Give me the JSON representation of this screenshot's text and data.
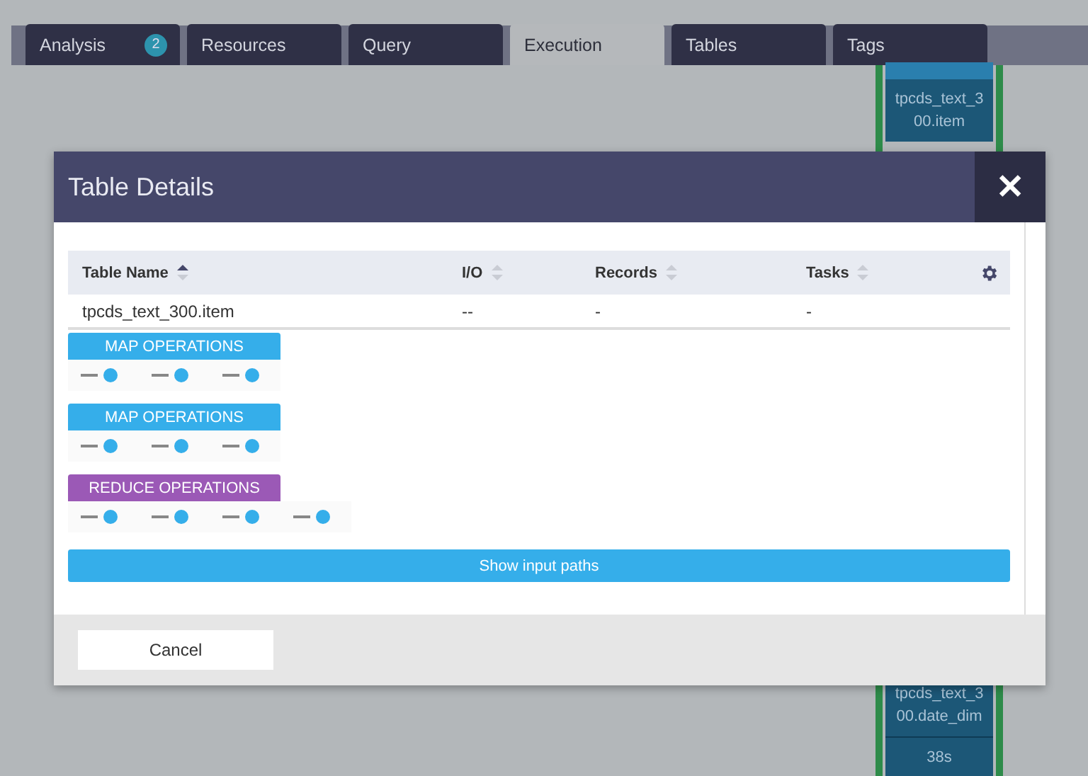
{
  "tabs": [
    {
      "label": "Analysis",
      "badge": "2",
      "selected": false
    },
    {
      "label": "Resources",
      "selected": false
    },
    {
      "label": "Query",
      "selected": false
    },
    {
      "label": "Execution",
      "selected": true
    },
    {
      "label": "Tables",
      "selected": false
    },
    {
      "label": "Tags",
      "selected": false
    }
  ],
  "background_nodes": [
    {
      "name": "tpcds_text_3 00.item"
    },
    {
      "name": "tpcds_text_3 00.date_dim",
      "duration": "38s"
    }
  ],
  "dialog": {
    "title": "Table Details",
    "close": "✕",
    "table": {
      "columns": [
        {
          "label": "Table Name",
          "sorted": true
        },
        {
          "label": "I/O",
          "sorted": false
        },
        {
          "label": "Records",
          "sorted": false
        },
        {
          "label": "Tasks",
          "sorted": false
        }
      ],
      "rows": [
        [
          "tpcds_text_300.item",
          "--",
          "-",
          "-"
        ]
      ]
    },
    "operations": [
      {
        "kind": "map",
        "label": "MAP OPERATIONS",
        "steps": [
          {
            "kind": "task"
          },
          {
            "kind": "task"
          },
          {
            "kind": "task"
          }
        ]
      },
      {
        "kind": "map",
        "label": "MAP OPERATIONS",
        "steps": [
          {
            "kind": "task"
          },
          {
            "kind": "task"
          },
          {
            "kind": "task"
          }
        ]
      },
      {
        "kind": "reduce",
        "label": "REDUCE OPERATIONS",
        "steps": [
          {
            "kind": "task"
          },
          {
            "kind": "task"
          },
          {
            "kind": "task"
          },
          {
            "kind": "task"
          }
        ]
      }
    ],
    "paths_button": "Show input paths",
    "buttons": [
      "Cancel"
    ]
  }
}
